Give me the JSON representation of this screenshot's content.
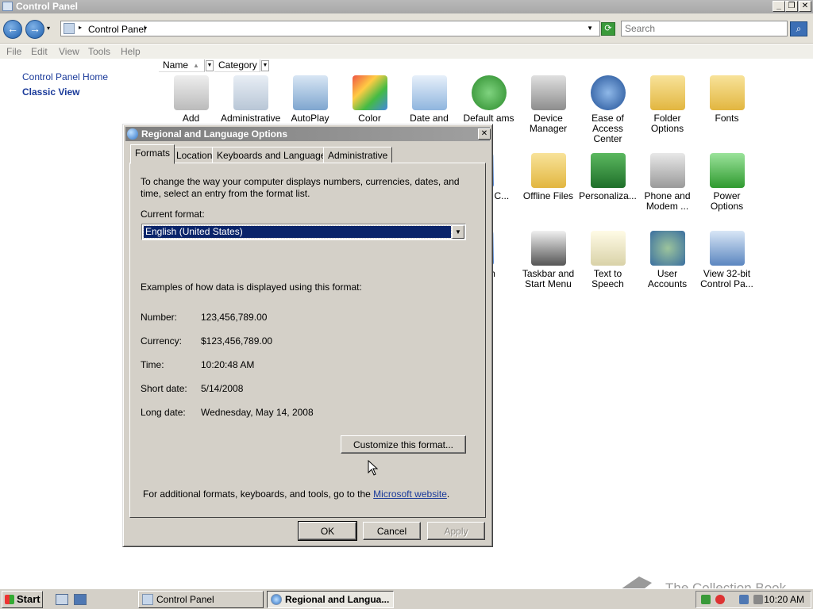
{
  "window": {
    "title": "Control Panel"
  },
  "address": {
    "crumb": "Control Panel",
    "search_placeholder": "Search"
  },
  "menu": [
    "File",
    "Edit",
    "View",
    "Tools",
    "Help"
  ],
  "left_pane": {
    "home": "Control Panel Home",
    "classic": "Classic View"
  },
  "columns": [
    "Name",
    "Category"
  ],
  "icons": [
    {
      "label": "Add Hardware",
      "color": "#d9d9d9"
    },
    {
      "label": "Administrative",
      "color": "#c9d2dc"
    },
    {
      "label": "AutoPlay",
      "color": "#b7cbe0"
    },
    {
      "label": "Color",
      "color": "#4a8fd8"
    },
    {
      "label": "Date and Time",
      "color": "#9fc2e7"
    },
    {
      "label": "Default ams",
      "color": "#3aa33a"
    },
    {
      "label": "Device Manager",
      "color": "#a7a7a7"
    },
    {
      "label": "Ease of Access Center",
      "color": "#2a5fa8"
    },
    {
      "label": "Folder Options",
      "color": "#f0cf6a"
    },
    {
      "label": "Fonts",
      "color": "#e8c35a"
    },
    {
      "label": "k and C...",
      "color": "#4b7fd0"
    },
    {
      "label": "Offline Files",
      "color": "#e9c45a"
    },
    {
      "label": "Personaliza...",
      "color": "#3e9a42"
    },
    {
      "label": "Phone and Modem ...",
      "color": "#a9a9a9"
    },
    {
      "label": "Power Options",
      "color": "#4db84d"
    },
    {
      "label": "em",
      "color": "#4b7fd0"
    },
    {
      "label": "Taskbar and Start Menu",
      "color": "#6f6f6f"
    },
    {
      "label": "Text to Speech",
      "color": "#e9e4c8"
    },
    {
      "label": "User Accounts",
      "color": "#4a7fb0"
    },
    {
      "label": "View 32-bit Control Pa...",
      "color": "#6e96c8"
    }
  ],
  "dialog": {
    "title": "Regional and Language Options",
    "tabs": [
      "Formats",
      "Location",
      "Keyboards and Languages",
      "Administrative"
    ],
    "intro": "To change the way your computer displays numbers, currencies, dates, and time, select an entry from the format list.",
    "current_format_label": "Current format:",
    "current_format_value": "English (United States)",
    "examples_heading": "Examples of how data is displayed using this format:",
    "examples": [
      {
        "label": "Number:",
        "value": "123,456,789.00"
      },
      {
        "label": "Currency:",
        "value": "$123,456,789.00"
      },
      {
        "label": "Time:",
        "value": "10:20:48 AM"
      },
      {
        "label": "Short date:",
        "value": "5/14/2008"
      },
      {
        "label": "Long date:",
        "value": "Wednesday, May 14, 2008"
      }
    ],
    "customize_button": "Customize this format...",
    "footer_text": "For additional formats, keyboards, and tools, go to the",
    "footer_link": "Microsoft website",
    "footer_end": ".",
    "ok": "OK",
    "cancel": "Cancel",
    "apply": "Apply"
  },
  "taskbar": {
    "start": "Start",
    "buttons": [
      "Control Panel",
      "Regional and Langua..."
    ],
    "clock": "10:20 AM"
  },
  "watermark": "The Collection Book"
}
